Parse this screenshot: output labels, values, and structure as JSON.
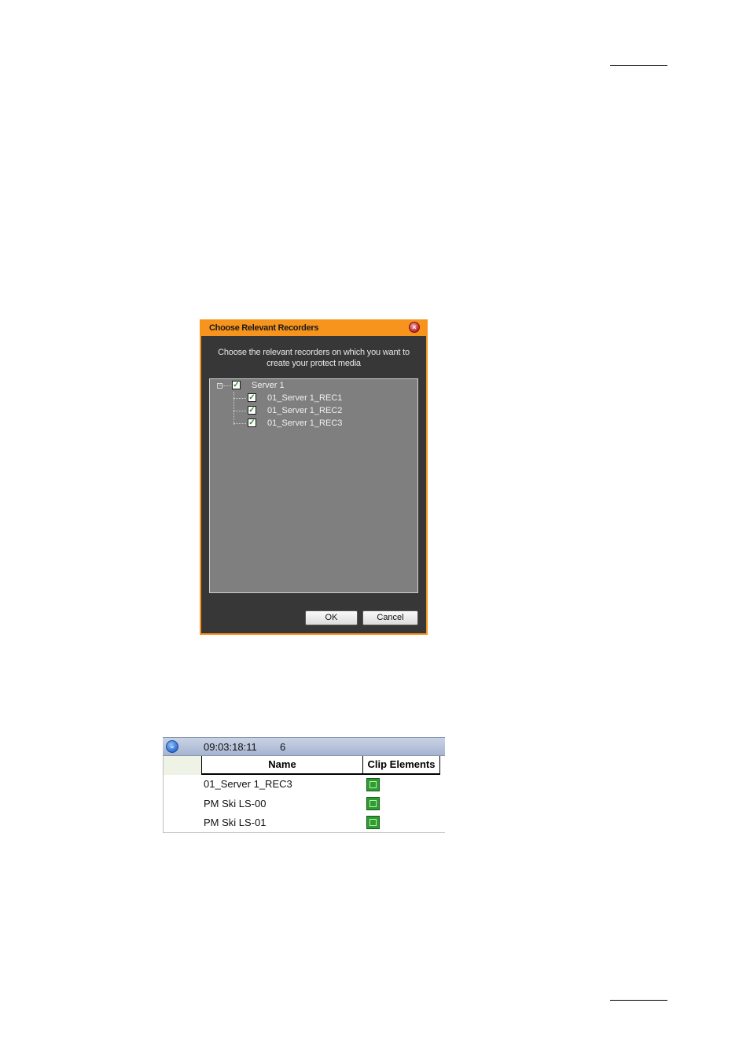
{
  "dialog": {
    "title": "Choose Relevant Recorders",
    "close_icon": "close-icon",
    "instruction": "Choose the relevant recorders on which you want to create your protect media",
    "tree": {
      "root": {
        "label": "Server 1",
        "checked": true,
        "expanded": true
      },
      "children": [
        {
          "label": "01_Server 1_REC1",
          "checked": true
        },
        {
          "label": "01_Server 1_REC2",
          "checked": true
        },
        {
          "label": "01_Server 1_REC3",
          "checked": true
        }
      ]
    },
    "ok_label": "OK",
    "cancel_label": "Cancel",
    "colors": {
      "frame": "#f7941d",
      "body": "#373737",
      "panel": "#7f7f7f"
    }
  },
  "clip_list": {
    "timecode": "09:03:18:11",
    "count": "6",
    "columns": [
      "Name",
      "Clip Elements"
    ],
    "rows": [
      {
        "name": "01_Server 1_REC3",
        "element_icon": "clip-element-icon"
      },
      {
        "name": "PM Ski LS-00",
        "element_icon": "clip-element-icon"
      },
      {
        "name": "PM Ski LS-01",
        "element_icon": "clip-element-icon"
      }
    ]
  }
}
